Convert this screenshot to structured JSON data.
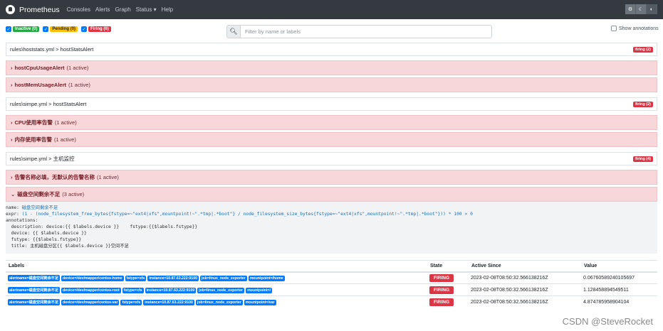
{
  "nav": {
    "brand": "Prometheus",
    "links": [
      "Consoles",
      "Alerts",
      "Graph",
      "Status ▾",
      "Help"
    ]
  },
  "theme_icons": [
    "gear-icon",
    "moon-icon",
    "contrast-icon"
  ],
  "filters": {
    "inactive": "Inactive (0)",
    "pending": "Pending (0)",
    "firing": "Firing (6)"
  },
  "search": {
    "placeholder": "Filter by name or labels"
  },
  "show_annotations": "Show annotations",
  "groups": [
    {
      "path": "rules\\hoststats.yml > hostStatsAlert",
      "badge": "firing (2)",
      "rules": [
        {
          "name": "hostCpuUsageAlert",
          "count": "(1 active)"
        },
        {
          "name": "hostMemUsageAlert",
          "count": "(1 active)"
        }
      ]
    },
    {
      "path": "rules\\simpe.yml > hostStatsAlert",
      "badge": "firing (2)",
      "rules": [
        {
          "name": "CPU使用率告警",
          "count": "(1 active)"
        },
        {
          "name": "内存使用率告警",
          "count": "(1 active)"
        }
      ]
    },
    {
      "path": "rules\\simpe.yml > 主机监控",
      "badge": "firing (4)",
      "rules": [
        {
          "name": "告警名称必填，无默认的告警名称",
          "count": "(1 active)"
        },
        {
          "name": "磁盘空间剩余不足",
          "count": "(3 active)"
        }
      ]
    }
  ],
  "expanded_rule": {
    "name_key": "name: ",
    "name_val": "磁盘空间剩余不足",
    "expr_key": "expr: ",
    "expr_val": "(1 - (node_filesystem_free_bytes{fstype=~\"ext4|xfs\",mountpoint!~\".*tmp|.*boot\"} / node_filesystem_size_bytes{fstype=~\"ext4|xfs\",mountpoint!~\".*tmp|.*boot\"})) * 100 > 0",
    "lines": [
      "annotations:",
      "  description: device:{{ $labels.device }}    fstype:{{$labels.fstype}}",
      "  device: {{ $labels.device }}",
      "  fstype: {{$labels.fstype}}",
      "  title: 主机磁盘分区{{ $labels.device }}空间不足"
    ]
  },
  "alerts_table": {
    "headers": [
      "Labels",
      "State",
      "Active Since",
      "Value"
    ],
    "rows": [
      {
        "labels": [
          "alertname=磁盘空间剩余不足",
          "device=/dev/mapper/centos-home",
          "fstype=xfs",
          "instance=10.87.63.222:9100",
          "job=linux_node_exporter",
          "mountpoint=/home"
        ],
        "state": "FIRING",
        "since": "2023-02-08T08:50:32.566138216Z",
        "value": "0.06760589240105697"
      },
      {
        "labels": [
          "alertname=磁盘空间剩余不足",
          "device=/dev/mapper/centos-root",
          "fstype=xfs",
          "instance=10.87.63.222:9100",
          "job=linux_node_exporter",
          "mountpoint=/"
        ],
        "state": "FIRING",
        "since": "2023-02-08T08:50:32.566138216Z",
        "value": "1.128458894549511"
      },
      {
        "labels": [
          "alertname=磁盘空间剩余不足",
          "device=/dev/mapper/centos-var",
          "fstype=xfs",
          "instance=10.87.63.222:9100",
          "job=linux_node_exporter",
          "mountpoint=/var"
        ],
        "state": "FIRING",
        "since": "2023-02-08T08:50:32.566138216Z",
        "value": "4.874785958904104"
      }
    ]
  },
  "watermark": "CSDN @SteveRocket"
}
